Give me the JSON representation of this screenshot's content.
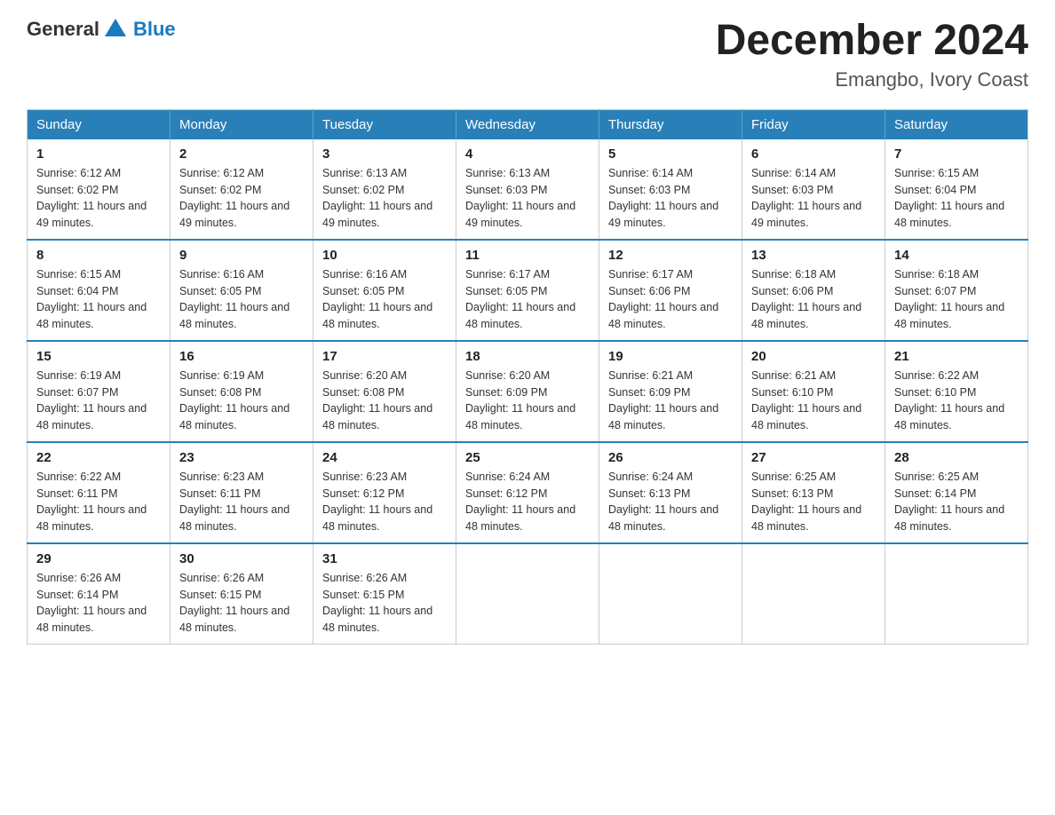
{
  "logo": {
    "text_general": "General",
    "text_blue": "Blue"
  },
  "title": "December 2024",
  "location": "Emangbo, Ivory Coast",
  "days_of_week": [
    "Sunday",
    "Monday",
    "Tuesday",
    "Wednesday",
    "Thursday",
    "Friday",
    "Saturday"
  ],
  "weeks": [
    [
      {
        "day": "1",
        "sunrise": "6:12 AM",
        "sunset": "6:02 PM",
        "daylight": "11 hours and 49 minutes."
      },
      {
        "day": "2",
        "sunrise": "6:12 AM",
        "sunset": "6:02 PM",
        "daylight": "11 hours and 49 minutes."
      },
      {
        "day": "3",
        "sunrise": "6:13 AM",
        "sunset": "6:02 PM",
        "daylight": "11 hours and 49 minutes."
      },
      {
        "day": "4",
        "sunrise": "6:13 AM",
        "sunset": "6:03 PM",
        "daylight": "11 hours and 49 minutes."
      },
      {
        "day": "5",
        "sunrise": "6:14 AM",
        "sunset": "6:03 PM",
        "daylight": "11 hours and 49 minutes."
      },
      {
        "day": "6",
        "sunrise": "6:14 AM",
        "sunset": "6:03 PM",
        "daylight": "11 hours and 49 minutes."
      },
      {
        "day": "7",
        "sunrise": "6:15 AM",
        "sunset": "6:04 PM",
        "daylight": "11 hours and 48 minutes."
      }
    ],
    [
      {
        "day": "8",
        "sunrise": "6:15 AM",
        "sunset": "6:04 PM",
        "daylight": "11 hours and 48 minutes."
      },
      {
        "day": "9",
        "sunrise": "6:16 AM",
        "sunset": "6:05 PM",
        "daylight": "11 hours and 48 minutes."
      },
      {
        "day": "10",
        "sunrise": "6:16 AM",
        "sunset": "6:05 PM",
        "daylight": "11 hours and 48 minutes."
      },
      {
        "day": "11",
        "sunrise": "6:17 AM",
        "sunset": "6:05 PM",
        "daylight": "11 hours and 48 minutes."
      },
      {
        "day": "12",
        "sunrise": "6:17 AM",
        "sunset": "6:06 PM",
        "daylight": "11 hours and 48 minutes."
      },
      {
        "day": "13",
        "sunrise": "6:18 AM",
        "sunset": "6:06 PM",
        "daylight": "11 hours and 48 minutes."
      },
      {
        "day": "14",
        "sunrise": "6:18 AM",
        "sunset": "6:07 PM",
        "daylight": "11 hours and 48 minutes."
      }
    ],
    [
      {
        "day": "15",
        "sunrise": "6:19 AM",
        "sunset": "6:07 PM",
        "daylight": "11 hours and 48 minutes."
      },
      {
        "day": "16",
        "sunrise": "6:19 AM",
        "sunset": "6:08 PM",
        "daylight": "11 hours and 48 minutes."
      },
      {
        "day": "17",
        "sunrise": "6:20 AM",
        "sunset": "6:08 PM",
        "daylight": "11 hours and 48 minutes."
      },
      {
        "day": "18",
        "sunrise": "6:20 AM",
        "sunset": "6:09 PM",
        "daylight": "11 hours and 48 minutes."
      },
      {
        "day": "19",
        "sunrise": "6:21 AM",
        "sunset": "6:09 PM",
        "daylight": "11 hours and 48 minutes."
      },
      {
        "day": "20",
        "sunrise": "6:21 AM",
        "sunset": "6:10 PM",
        "daylight": "11 hours and 48 minutes."
      },
      {
        "day": "21",
        "sunrise": "6:22 AM",
        "sunset": "6:10 PM",
        "daylight": "11 hours and 48 minutes."
      }
    ],
    [
      {
        "day": "22",
        "sunrise": "6:22 AM",
        "sunset": "6:11 PM",
        "daylight": "11 hours and 48 minutes."
      },
      {
        "day": "23",
        "sunrise": "6:23 AM",
        "sunset": "6:11 PM",
        "daylight": "11 hours and 48 minutes."
      },
      {
        "day": "24",
        "sunrise": "6:23 AM",
        "sunset": "6:12 PM",
        "daylight": "11 hours and 48 minutes."
      },
      {
        "day": "25",
        "sunrise": "6:24 AM",
        "sunset": "6:12 PM",
        "daylight": "11 hours and 48 minutes."
      },
      {
        "day": "26",
        "sunrise": "6:24 AM",
        "sunset": "6:13 PM",
        "daylight": "11 hours and 48 minutes."
      },
      {
        "day": "27",
        "sunrise": "6:25 AM",
        "sunset": "6:13 PM",
        "daylight": "11 hours and 48 minutes."
      },
      {
        "day": "28",
        "sunrise": "6:25 AM",
        "sunset": "6:14 PM",
        "daylight": "11 hours and 48 minutes."
      }
    ],
    [
      {
        "day": "29",
        "sunrise": "6:26 AM",
        "sunset": "6:14 PM",
        "daylight": "11 hours and 48 minutes."
      },
      {
        "day": "30",
        "sunrise": "6:26 AM",
        "sunset": "6:15 PM",
        "daylight": "11 hours and 48 minutes."
      },
      {
        "day": "31",
        "sunrise": "6:26 AM",
        "sunset": "6:15 PM",
        "daylight": "11 hours and 48 minutes."
      },
      null,
      null,
      null,
      null
    ]
  ]
}
